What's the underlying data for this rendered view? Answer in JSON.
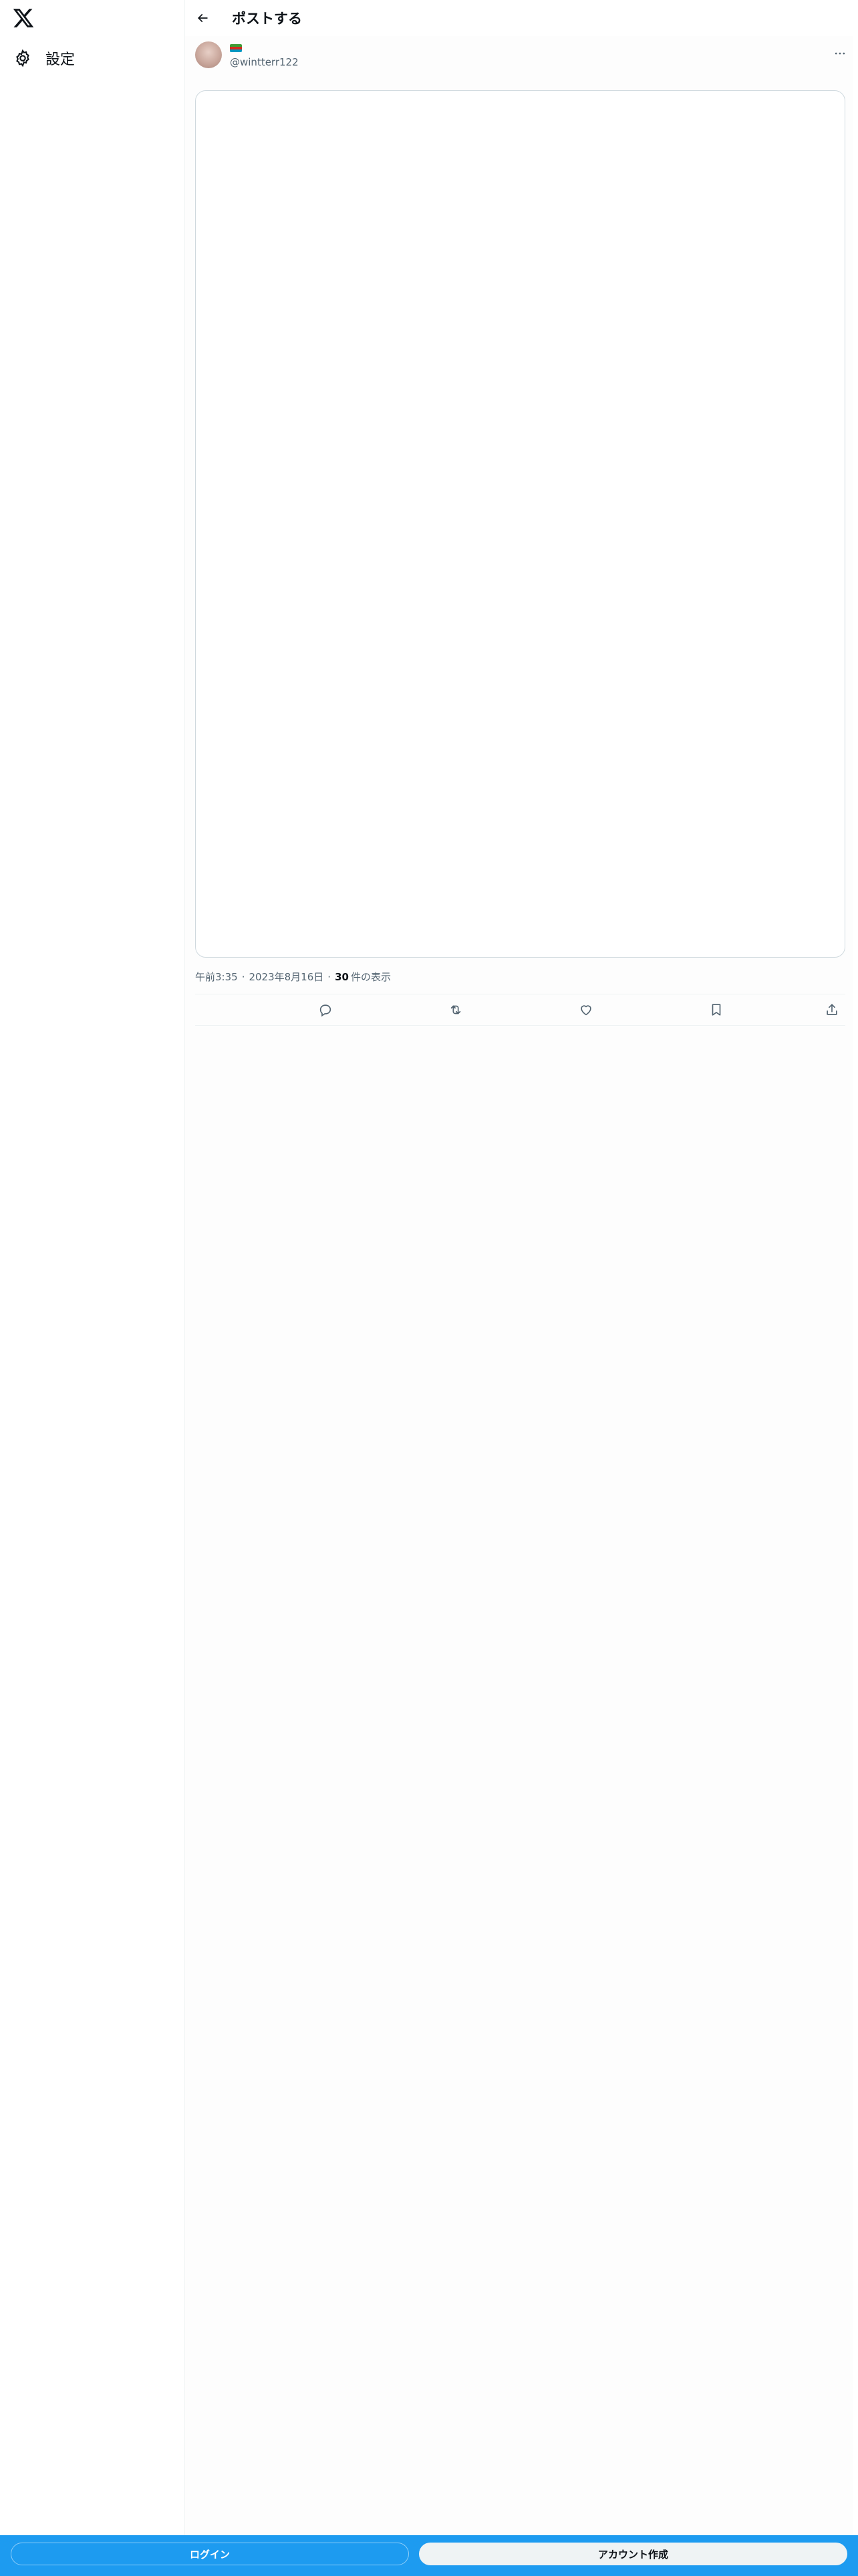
{
  "sidebar": {
    "logo_icon": "x-logo-icon",
    "items": [
      {
        "label": "設定",
        "icon": "gear-icon"
      }
    ]
  },
  "header": {
    "title": "ポストする",
    "back_icon": "back-arrow-icon"
  },
  "post": {
    "author": {
      "display_name_flag": "flag-emoji",
      "handle": "@wintterr122"
    },
    "more_icon": "more-icon",
    "meta": {
      "time": "午前3:35",
      "separator": "·",
      "date": "2023年8月16日",
      "views_count": "30",
      "views_label": "件の表示"
    },
    "actions": [
      {
        "name": "reply",
        "icon": "reply-icon"
      },
      {
        "name": "repost",
        "icon": "repost-icon"
      },
      {
        "name": "like",
        "icon": "heart-icon"
      },
      {
        "name": "bookmark",
        "icon": "bookmark-icon"
      },
      {
        "name": "share",
        "icon": "share-icon"
      }
    ]
  },
  "bottom_bar": {
    "login_label": "ログイン",
    "signup_label": "アカウント作成"
  },
  "colors": {
    "accent": "#1d9bf0",
    "text_primary": "#0f1419",
    "text_secondary": "#536471",
    "border": "#cfd9de"
  }
}
